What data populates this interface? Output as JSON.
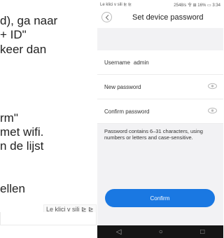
{
  "document": {
    "lines": [
      "d), ga naar",
      "+ ID\"",
      "keer dan",
      "rm\"",
      "met wifi.",
      "n de lijst",
      "ellen"
    ],
    "caption": "Le klici v sili ⊵ ⊵"
  },
  "phone": {
    "statusbar": {
      "left": "Le klici v sili ⊵ ⊵",
      "right": "2548/s 令 ⊞ 16% ▭ 3:34"
    },
    "appbar": {
      "back_icon": "chevron-left-icon",
      "title": "Set device password"
    },
    "form": {
      "username_label": "Username",
      "username_value": "admin",
      "new_password_label": "New password",
      "confirm_password_label": "Confirm password",
      "eye_icon": "eye-icon"
    },
    "hint": "Password contains 6–31 characters, using numbers or letters and case-sensitive.",
    "confirm_label": "Confirm",
    "navbar": {
      "back": "◁",
      "home": "○",
      "recents": "□"
    }
  }
}
